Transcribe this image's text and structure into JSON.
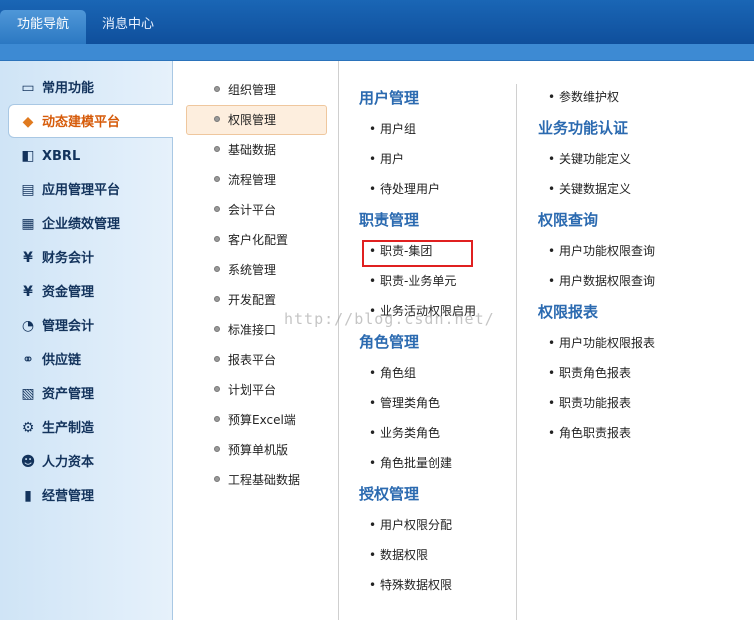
{
  "tabs": [
    {
      "label": "功能导航"
    },
    {
      "label": "消息中心"
    }
  ],
  "leftnav": [
    {
      "label": "常用功能",
      "icon": "monitor-icon",
      "glyph": "▭"
    },
    {
      "label": "动态建模平台",
      "icon": "cube-icon",
      "glyph": "◆"
    },
    {
      "label": "XBRL",
      "icon": "xbrl-icon",
      "glyph": "◧"
    },
    {
      "label": "应用管理平台",
      "icon": "app-icon",
      "glyph": "▤"
    },
    {
      "label": "企业绩效管理",
      "icon": "calculator-icon",
      "glyph": "▦"
    },
    {
      "label": "财务会计",
      "icon": "yen-doc-icon",
      "glyph": "¥"
    },
    {
      "label": "资金管理",
      "icon": "yen-icon",
      "glyph": "¥"
    },
    {
      "label": "管理会计",
      "icon": "gauge-icon",
      "glyph": "◔"
    },
    {
      "label": "供应链",
      "icon": "link-icon",
      "glyph": "⚭"
    },
    {
      "label": "资产管理",
      "icon": "asset-icon",
      "glyph": "▧"
    },
    {
      "label": "生产制造",
      "icon": "gear-icon",
      "glyph": "⚙"
    },
    {
      "label": "人力资本",
      "icon": "people-icon",
      "glyph": "☻"
    },
    {
      "label": "经营管理",
      "icon": "book-icon",
      "glyph": "▮"
    }
  ],
  "midcol": [
    "组织管理",
    "权限管理",
    "基础数据",
    "流程管理",
    "会计平台",
    "客户化配置",
    "系统管理",
    "开发配置",
    "标准接口",
    "报表平台",
    "计划平台",
    "预算Excel端",
    "预算单机版",
    "工程基础数据"
  ],
  "sections": {
    "user_mgmt": {
      "title": "用户管理",
      "items": [
        "用户组",
        "用户",
        "待处理用户"
      ]
    },
    "duty_mgmt": {
      "title": "职责管理",
      "items": [
        "职责-集团",
        "职责-业务单元",
        "业务活动权限启用"
      ]
    },
    "role_mgmt": {
      "title": "角色管理",
      "items": [
        "角色组",
        "管理类角色",
        "业务类角色",
        "角色批量创建"
      ]
    },
    "auth_mgmt": {
      "title": "授权管理",
      "items": [
        "用户权限分配",
        "数据权限",
        "特殊数据权限"
      ]
    },
    "param": {
      "items": [
        "参数维护权"
      ]
    },
    "biz_auth": {
      "title": "业务功能认证",
      "items": [
        "关键功能定义",
        "关键数据定义"
      ]
    },
    "perm_query": {
      "title": "权限查询",
      "items": [
        "用户功能权限查询",
        "用户数据权限查询"
      ]
    },
    "perm_report": {
      "title": "权限报表",
      "items": [
        "用户功能权限报表",
        "职责角色报表",
        "职责功能报表",
        "角色职责报表"
      ]
    }
  },
  "watermark": "http://blog.csdn.net/",
  "colors": {
    "accent": "#2b6ab0",
    "active_nav": "#d65b0a",
    "highlight_box": "#e02020"
  }
}
